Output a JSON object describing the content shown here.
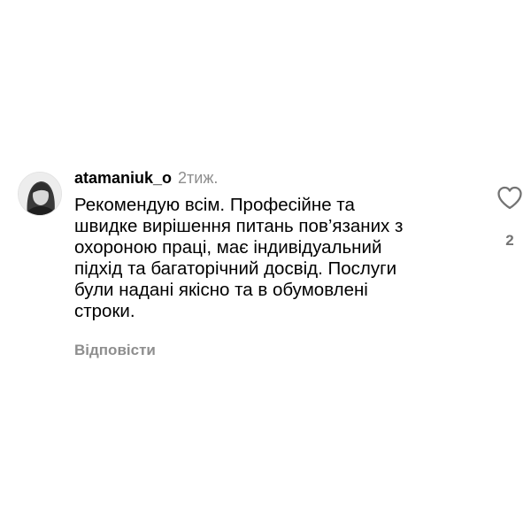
{
  "comment": {
    "username": "atamaniuk_o",
    "time": "2тиж.",
    "text": "Рекомендую всім. Професійне та\nшвидке вирішення питань пов’язаних з\nохороною праці, має індивідуальний\nпідхід та багаторічний досвід. Послуги\nбули надані якісно та в обумовлені\nстроки.",
    "reply_label": "Відповісти",
    "like_icon": "heart-outline-icon",
    "likes": "2"
  }
}
